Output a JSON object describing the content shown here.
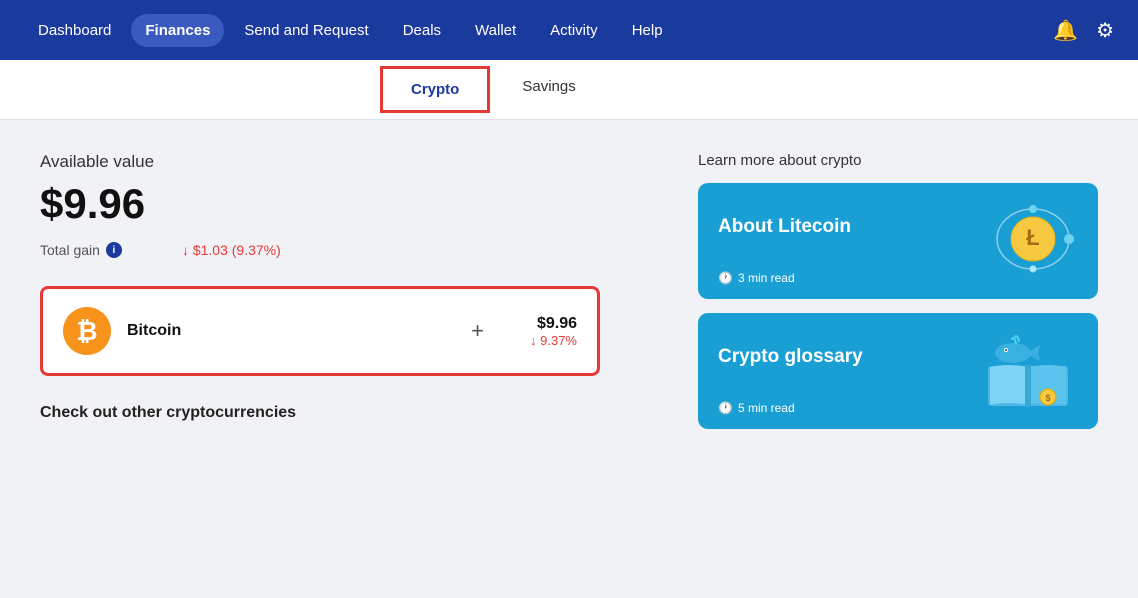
{
  "nav": {
    "items": [
      {
        "label": "Dashboard",
        "active": false
      },
      {
        "label": "Finances",
        "active": true
      },
      {
        "label": "Send and Request",
        "active": false
      },
      {
        "label": "Deals",
        "active": false
      },
      {
        "label": "Wallet",
        "active": false
      },
      {
        "label": "Activity",
        "active": false
      },
      {
        "label": "Help",
        "active": false
      }
    ]
  },
  "tabs": [
    {
      "label": "Crypto",
      "active": true
    },
    {
      "label": "Savings",
      "active": false
    }
  ],
  "main": {
    "available_label": "Available value",
    "available_value": "$9.96",
    "total_gain_label": "Total gain",
    "total_gain_value": "↓ $1.03 (9.37%)",
    "crypto_name": "Bitcoin",
    "crypto_usd": "$9.96",
    "crypto_pct": "↓ 9.37%",
    "check_other": "Check out other cryptocurrencies"
  },
  "learn": {
    "title": "Learn more about crypto",
    "cards": [
      {
        "title": "About Litecoin",
        "read_time": "3 min read"
      },
      {
        "title": "Crypto glossary",
        "read_time": "5 min read"
      }
    ]
  }
}
